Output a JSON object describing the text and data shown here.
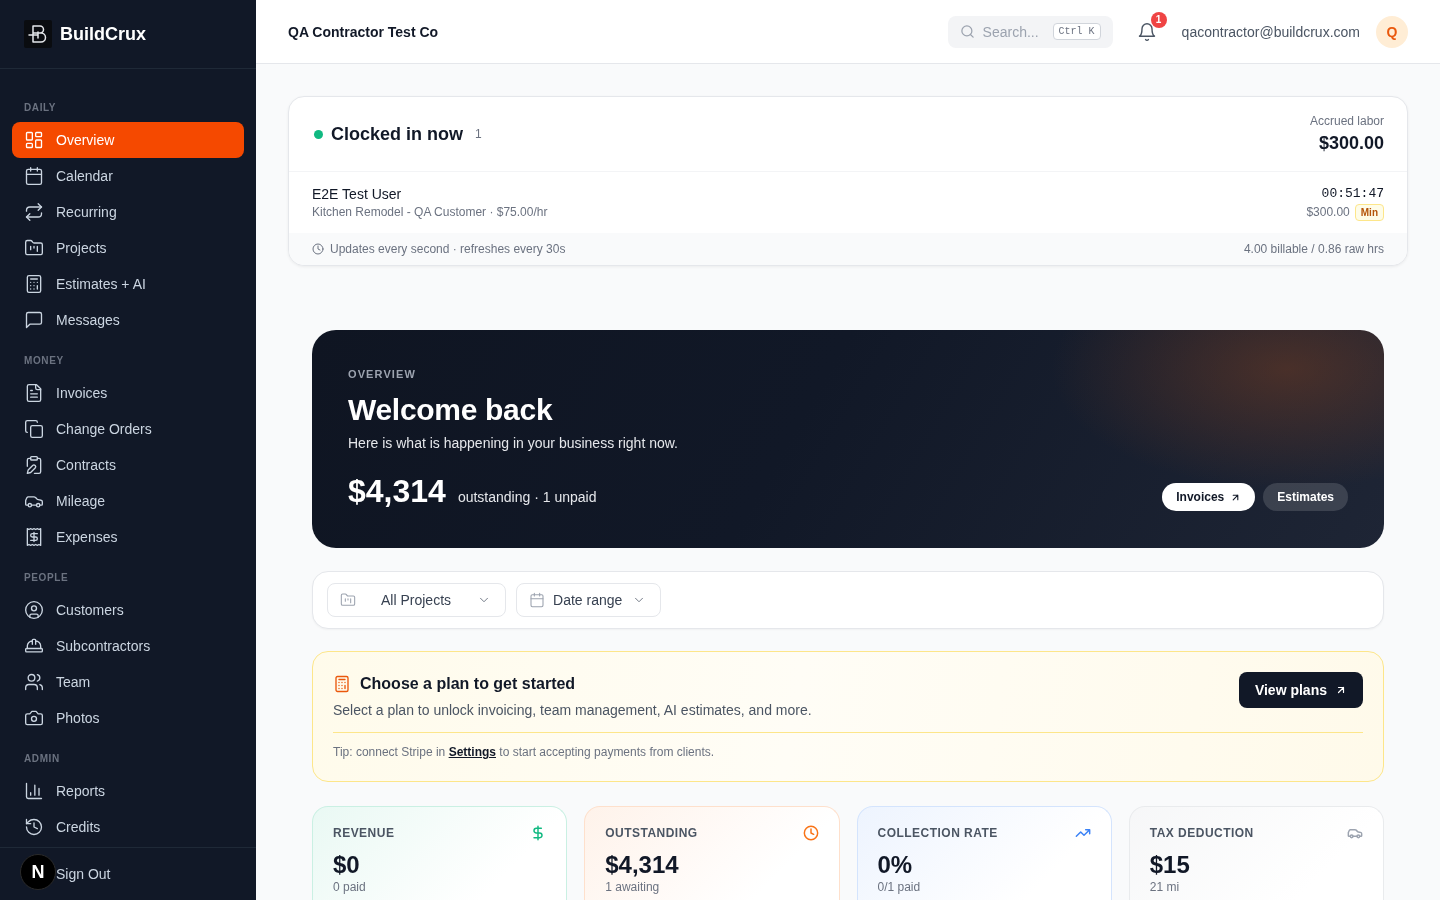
{
  "sidebar": {
    "brand": "BuildCrux",
    "sections": [
      {
        "label": "DAILY",
        "items": [
          {
            "label": "Overview",
            "selected": true
          },
          {
            "label": "Calendar",
            "selected": false
          },
          {
            "label": "Recurring",
            "selected": false
          },
          {
            "label": "Projects",
            "selected": false
          },
          {
            "label": "Estimates + AI",
            "selected": false
          },
          {
            "label": "Messages",
            "selected": false
          }
        ]
      },
      {
        "label": "MONEY",
        "items": [
          {
            "label": "Invoices",
            "selected": false
          },
          {
            "label": "Change Orders",
            "selected": false
          },
          {
            "label": "Contracts",
            "selected": false
          },
          {
            "label": "Mileage",
            "selected": false
          },
          {
            "label": "Expenses",
            "selected": false
          }
        ]
      },
      {
        "label": "PEOPLE",
        "items": [
          {
            "label": "Customers",
            "selected": false
          },
          {
            "label": "Subcontractors",
            "selected": false
          },
          {
            "label": "Team",
            "selected": false
          },
          {
            "label": "Photos",
            "selected": false
          }
        ]
      },
      {
        "label": "ADMIN",
        "items": [
          {
            "label": "Reports",
            "selected": false
          },
          {
            "label": "Credits",
            "selected": false
          }
        ]
      }
    ],
    "sign_out": "Sign Out",
    "dev_badge": "N"
  },
  "header": {
    "company": "QA Contractor Test Co",
    "search": {
      "placeholder": "Search...",
      "shortcut": "Ctrl K"
    },
    "notifications": "1",
    "email": "qacontractor@buildcrux.com",
    "avatar": "Q"
  },
  "clocked_in": {
    "title": "Clocked in now",
    "count": "1",
    "accrued_label": "Accrued labor",
    "accrued_value": "$300.00",
    "entries": [
      {
        "name": "E2E Test User",
        "details": "Kitchen Remodel - QA Customer · $75.00/hr",
        "timer": "00:51:47",
        "amount": "$300.00",
        "badge": "Min"
      }
    ],
    "footer_note": "Updates every second · refreshes every 30s",
    "footer_hours": "4.00 billable / 0.86 raw hrs"
  },
  "banner": {
    "eyebrow": "OVERVIEW",
    "title": "Welcome back",
    "subtitle": "Here is what is happening in your business right now.",
    "amount": "$4,314",
    "amount_note": "outstanding · 1 unpaid",
    "buttons": [
      {
        "label": "Invoices",
        "kind": "primary"
      },
      {
        "label": "Estimates",
        "kind": "secondary"
      }
    ]
  },
  "filters": [
    {
      "label": "All Projects",
      "kind": "select"
    },
    {
      "label": "Date range",
      "kind": "date_range"
    }
  ],
  "plan_notice": {
    "title": "Choose a plan to get started",
    "body": "Select a plan to unlock invoicing, team management, AI estimates, and more.",
    "button": "View plans",
    "tip_before": "Tip: connect Stripe in",
    "tip_link": "Settings",
    "tip_after": "to start accepting payments from clients."
  },
  "stats": [
    {
      "label": "REVENUE",
      "value": "$0",
      "note": "0 paid",
      "color": "#10b981"
    },
    {
      "label": "OUTSTANDING",
      "value": "$4,314",
      "note": "1 awaiting",
      "color": "#f97316"
    },
    {
      "label": "COLLECTION RATE",
      "value": "0%",
      "note": "0/1 paid",
      "color": "#3b82f6"
    },
    {
      "label": "TAX DEDUCTION",
      "value": "$15",
      "note": "21 mi",
      "color": "#9ca3af"
    }
  ]
}
